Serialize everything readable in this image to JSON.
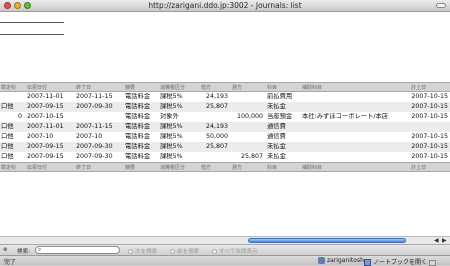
{
  "window": {
    "title": "http://zarigani.ddo.jp:3002 - Journals: list"
  },
  "columns": [
    "勘定科",
    "伝票日付",
    "終了日",
    "摘要",
    "消費税区分",
    "借方",
    "貸方",
    "科目",
    "補助科目",
    "計上日"
  ],
  "rows": [
    {
      "c0": "",
      "c1": "2007-11-01",
      "c2": "2007-11-15",
      "c3": "電話料金",
      "c4": "課税5%",
      "c5": "24,193",
      "c6": "",
      "c7": "前払費用",
      "c8": "",
      "c9": "2007-10-15"
    },
    {
      "c0": "口他",
      "c1": "2007-09-15",
      "c2": "2007-09-30",
      "c3": "電話料金",
      "c4": "課税5%",
      "c5": "25,807",
      "c6": "",
      "c7": "未払金",
      "c8": "",
      "c9": "2007-10-15"
    },
    {
      "c0": "0",
      "c1": "2007-10-15",
      "c2": "",
      "c3": "電話料金",
      "c4": "対象外",
      "c5": "",
      "c6": "100,000",
      "c7": "当座預金",
      "c8": "本社:みずほコーポレート/本店",
      "c9": "2007-10-15"
    },
    {
      "c0": "口他",
      "c1": "2007-11-01",
      "c2": "2007-11-15",
      "c3": "電話料金",
      "c4": "課税5%",
      "c5": "24,193",
      "c6": "",
      "c7": "通信費",
      "c8": "",
      "c9": ""
    },
    {
      "c0": "口他",
      "c1": "2007-10",
      "c2": "2007-10",
      "c3": "電話料金",
      "c4": "課税5%",
      "c5": "50,000",
      "c6": "",
      "c7": "通信費",
      "c8": "",
      "c9": "2007-10-15"
    },
    {
      "c0": "口他",
      "c1": "2007-09-15",
      "c2": "2007-09-30",
      "c3": "電話料金",
      "c4": "課税5%",
      "c5": "25,807",
      "c6": "",
      "c7": "未払金",
      "c8": "",
      "c9": "2007-10-15"
    },
    {
      "c0": "口他",
      "c1": "2007-09-15",
      "c2": "2007-09-30",
      "c3": "電話料金",
      "c4": "課税5%",
      "c5": "",
      "c6": "25,807",
      "c7": "未払金",
      "c8": "",
      "c9": "2007-10-15"
    }
  ],
  "findbar": {
    "label": "検索:",
    "search_value": "",
    "prev_label": "次を検索",
    "next_label": "前を検索",
    "all_label": "すべて強調表示"
  },
  "status": {
    "left": "完了",
    "user": "zariganitosh",
    "notebook": "ノートブックを開く"
  }
}
